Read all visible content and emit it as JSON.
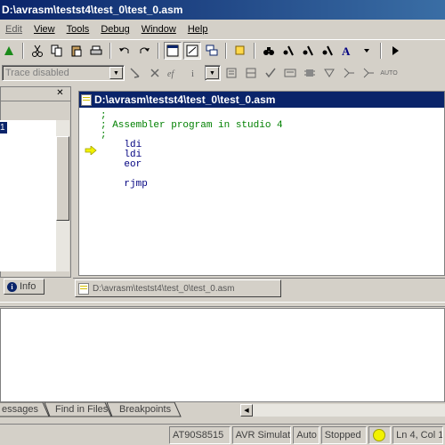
{
  "window": {
    "title": "D:\\avrasm\\testst4\\test_0\\test_0.asm"
  },
  "menu": [
    {
      "label": "Edit",
      "underline_index": 0,
      "enabled": false
    },
    {
      "label": "View",
      "underline_index": 0,
      "enabled": true
    },
    {
      "label": "Tools",
      "underline_index": 0,
      "enabled": true
    },
    {
      "label": "Debug",
      "underline_index": 0,
      "enabled": true
    },
    {
      "label": "Window",
      "underline_index": 0,
      "enabled": true
    },
    {
      "label": "Help",
      "underline_index": 0,
      "enabled": true
    }
  ],
  "toolbar2": {
    "trace_dropdown": "Trace disabled",
    "auto_label": "AUTO"
  },
  "editor": {
    "title": "D:\\avrasm\\testst4\\test_0\\test_0.asm",
    "lines": [
      {
        "text": ";",
        "kind": "comment"
      },
      {
        "text": "; Assembler program in studio 4",
        "kind": "comment"
      },
      {
        "text": ";",
        "kind": "comment"
      },
      {
        "text": "    ldi",
        "kind": "kw"
      },
      {
        "text": "    ldi",
        "kind": "kw"
      },
      {
        "text": "    eor",
        "kind": "kw"
      },
      {
        "text": "",
        "kind": "kw"
      },
      {
        "text": "    rjmp",
        "kind": "kw"
      }
    ]
  },
  "workspace": {
    "tab_label": "Info",
    "selected_char": "1"
  },
  "document_tab": {
    "label": "D:\\avrasm\\testst4\\test_0\\test_0.asm"
  },
  "output_tabs": [
    "essages",
    "Find in Files",
    "Breakpoints"
  ],
  "status": {
    "device": "AT90S8515",
    "platform": "AVR Simulator",
    "mode": "Auto",
    "state": "Stopped",
    "position": "Ln 4, Col 1"
  },
  "colors": {
    "title_active": "#0a246a",
    "comment": "#008000",
    "keyword": "#000080",
    "led": "#f2f200"
  }
}
